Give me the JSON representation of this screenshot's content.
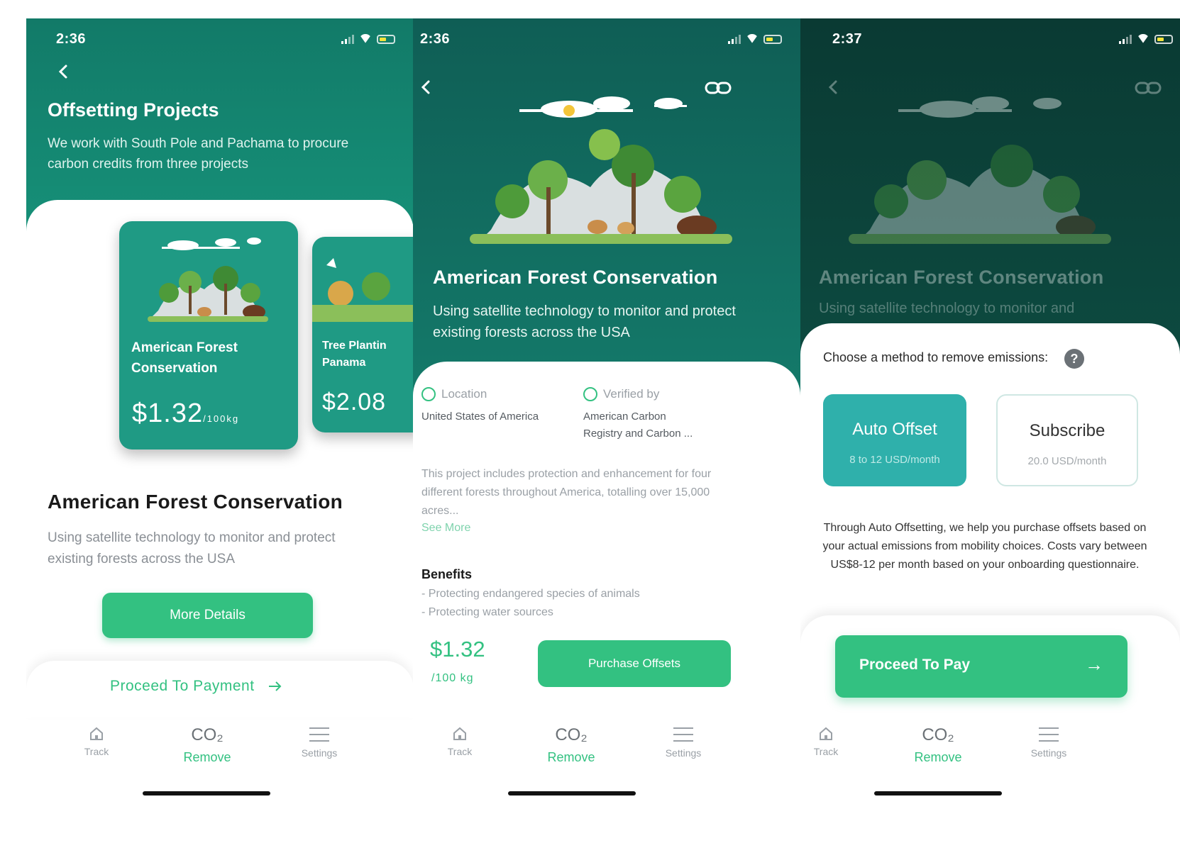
{
  "screens": [
    {
      "time": "2:36",
      "title": "Offsetting Projects",
      "subtitle": "We work with South Pole and Pachama to procure carbon credits from three projects",
      "cards": [
        {
          "title": "American Forest Conservation",
          "price": "$1.32",
          "unit": "/100kg"
        },
        {
          "title": "Tree Plantin Panama",
          "price": "$2.08"
        }
      ],
      "project_title": "American Forest Conservation",
      "project_desc": "Using satellite technology to monitor and protect existing forests across the USA",
      "more_details": "More Details",
      "proceed_payment": "Proceed To Payment"
    },
    {
      "time": "2:36",
      "title": "American Forest Conservation",
      "subtitle": "Using satellite technology to monitor and protect existing forests across the USA",
      "location_label": "Location",
      "location_value": "United States of America",
      "verified_label": "Verified by",
      "verified_value_1": "American Carbon",
      "verified_value_2": "Registry and Carbon ...",
      "description": "This project includes protection and enhancement for four different forests throughout America, totalling over 15,000 acres...",
      "see_more": "See More",
      "benefits_title": "Benefits",
      "benefits": [
        "- Protecting endangered species of animals",
        "- Protecting water sources"
      ],
      "price": "$1.32",
      "price_unit": "/100 kg",
      "purchase": "Purchase Offsets"
    },
    {
      "time": "2:37",
      "title": "American Forest Conservation",
      "subtitle": "Using satellite technology to monitor and",
      "choose": "Choose a method to remove emissions:",
      "help": "?",
      "options": [
        {
          "name": "Auto Offset",
          "price": "8 to 12 USD/month"
        },
        {
          "name": "Subscribe",
          "price": "20.0 USD/month"
        }
      ],
      "explanation": "Through Auto Offsetting, we help you purchase offsets based on your actual emissions from mobility choices. Costs vary between US$8-12 per month based on your onboarding questionnaire.",
      "proceed": "Proceed To Pay",
      "proceed_arrow": "→"
    }
  ],
  "nav": {
    "track": "Track",
    "co2": "CO₂",
    "remove": "Remove",
    "settings": "Settings"
  },
  "colors": {
    "primary": "#33c181",
    "header_teal": "#127a68",
    "card_teal": "#1f9a84",
    "auto_offset": "#2fb0ab"
  }
}
